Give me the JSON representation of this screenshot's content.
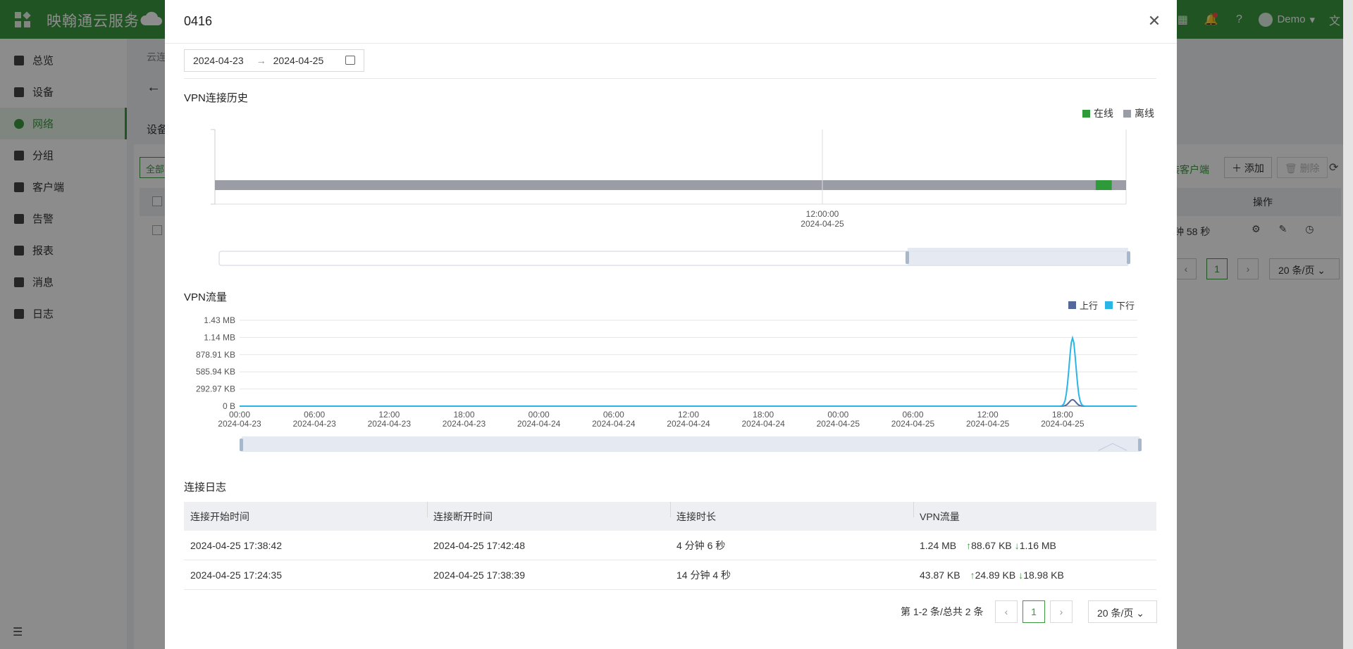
{
  "app": {
    "brand": "映翰通云服务",
    "user": "Demo",
    "sidebar": [
      {
        "label": "总览",
        "icon": "dashboard-icon"
      },
      {
        "label": "设备",
        "icon": "device-icon"
      },
      {
        "label": "网络",
        "icon": "globe-icon",
        "active": true
      },
      {
        "label": "分组",
        "icon": "group-icon"
      },
      {
        "label": "客户端",
        "icon": "client-icon"
      },
      {
        "label": "告警",
        "icon": "alarm-icon"
      },
      {
        "label": "报表",
        "icon": "report-icon"
      },
      {
        "label": "消息",
        "icon": "message-icon"
      },
      {
        "label": "日志",
        "icon": "log-icon"
      }
    ],
    "crumb": "云连",
    "tab": "设备",
    "all_button": "全部",
    "client_link": "装客户端",
    "add_button": "添加",
    "delete_button": "删除",
    "ops_header": "操作",
    "duration_cell": "钟 58 秒",
    "page_current": "1",
    "page_size": "20 条/页"
  },
  "modal": {
    "title": "0416",
    "date_range": {
      "start": "2024-04-23",
      "end": "2024-04-25"
    },
    "history": {
      "title": "VPN连接历史",
      "legend": [
        {
          "label": "在线",
          "color": "#2e9a3a"
        },
        {
          "label": "离线",
          "color": "#9a9ca6"
        }
      ],
      "tick_time": "12:00:00",
      "tick_date": "2024-04-25"
    },
    "traffic": {
      "title": "VPN流量",
      "legend": [
        {
          "label": "上行",
          "color": "#56689a"
        },
        {
          "label": "下行",
          "color": "#29b6e6"
        }
      ]
    },
    "log": {
      "title": "连接日志",
      "headers": [
        "连接开始时间",
        "连接断开时间",
        "连接时长",
        "VPN流量"
      ],
      "rows": [
        {
          "start": "2024-04-25 17:38:42",
          "end": "2024-04-25 17:42:48",
          "duration": "4 分钟 6 秒",
          "total": "1.24 MB",
          "up": "88.67 KB",
          "down": "1.16 MB"
        },
        {
          "start": "2024-04-25 17:24:35",
          "end": "2024-04-25 17:38:39",
          "duration": "14 分钟 4 秒",
          "total": "43.87 KB",
          "up": "24.89 KB",
          "down": "18.98 KB"
        }
      ]
    },
    "pagination": {
      "summary": "第 1-2 条/总共 2 条",
      "current": "1",
      "size": "20 条/页"
    }
  },
  "chart_data": [
    {
      "type": "bar",
      "title": "VPN连接历史",
      "x_range": [
        "2024-04-25 00:00:00",
        "2024-04-25 18:00:00"
      ],
      "x_ticks": [
        {
          "time": "12:00:00",
          "date": "2024-04-25"
        }
      ],
      "series": [
        {
          "name": "离线",
          "color": "#9a9ca6",
          "intervals": [
            [
              "2024-04-25 00:00",
              "2024-04-25 18:00"
            ]
          ]
        },
        {
          "name": "在线",
          "color": "#2e9a3a",
          "intervals": [
            [
              "2024-04-25 17:24",
              "2024-04-25 17:43"
            ]
          ]
        }
      ],
      "legend": "top-right"
    },
    {
      "type": "line",
      "title": "VPN流量",
      "y_ticks": [
        "0 B",
        "292.97 KB",
        "585.94 KB",
        "878.91 KB",
        "1.14 MB",
        "1.43 MB"
      ],
      "ylim_bytes": [
        0,
        1500000
      ],
      "x_ticks": [
        {
          "time": "00:00",
          "date": "2024-04-23"
        },
        {
          "time": "06:00",
          "date": "2024-04-23"
        },
        {
          "time": "12:00",
          "date": "2024-04-23"
        },
        {
          "time": "18:00",
          "date": "2024-04-23"
        },
        {
          "time": "00:00",
          "date": "2024-04-24"
        },
        {
          "time": "06:00",
          "date": "2024-04-24"
        },
        {
          "time": "12:00",
          "date": "2024-04-24"
        },
        {
          "time": "18:00",
          "date": "2024-04-24"
        },
        {
          "time": "00:00",
          "date": "2024-04-25"
        },
        {
          "time": "06:00",
          "date": "2024-04-25"
        },
        {
          "time": "12:00",
          "date": "2024-04-25"
        },
        {
          "time": "18:00",
          "date": "2024-04-25"
        }
      ],
      "x_range_hours": [
        0,
        72
      ],
      "series": [
        {
          "name": "上行",
          "color": "#56689a",
          "peak_hour": 66.8,
          "peak_bytes": 113500
        },
        {
          "name": "下行",
          "color": "#29b6e6",
          "peak_hour": 66.8,
          "peak_bytes": 1190000
        }
      ],
      "legend": "top-right",
      "grid": true
    }
  ]
}
